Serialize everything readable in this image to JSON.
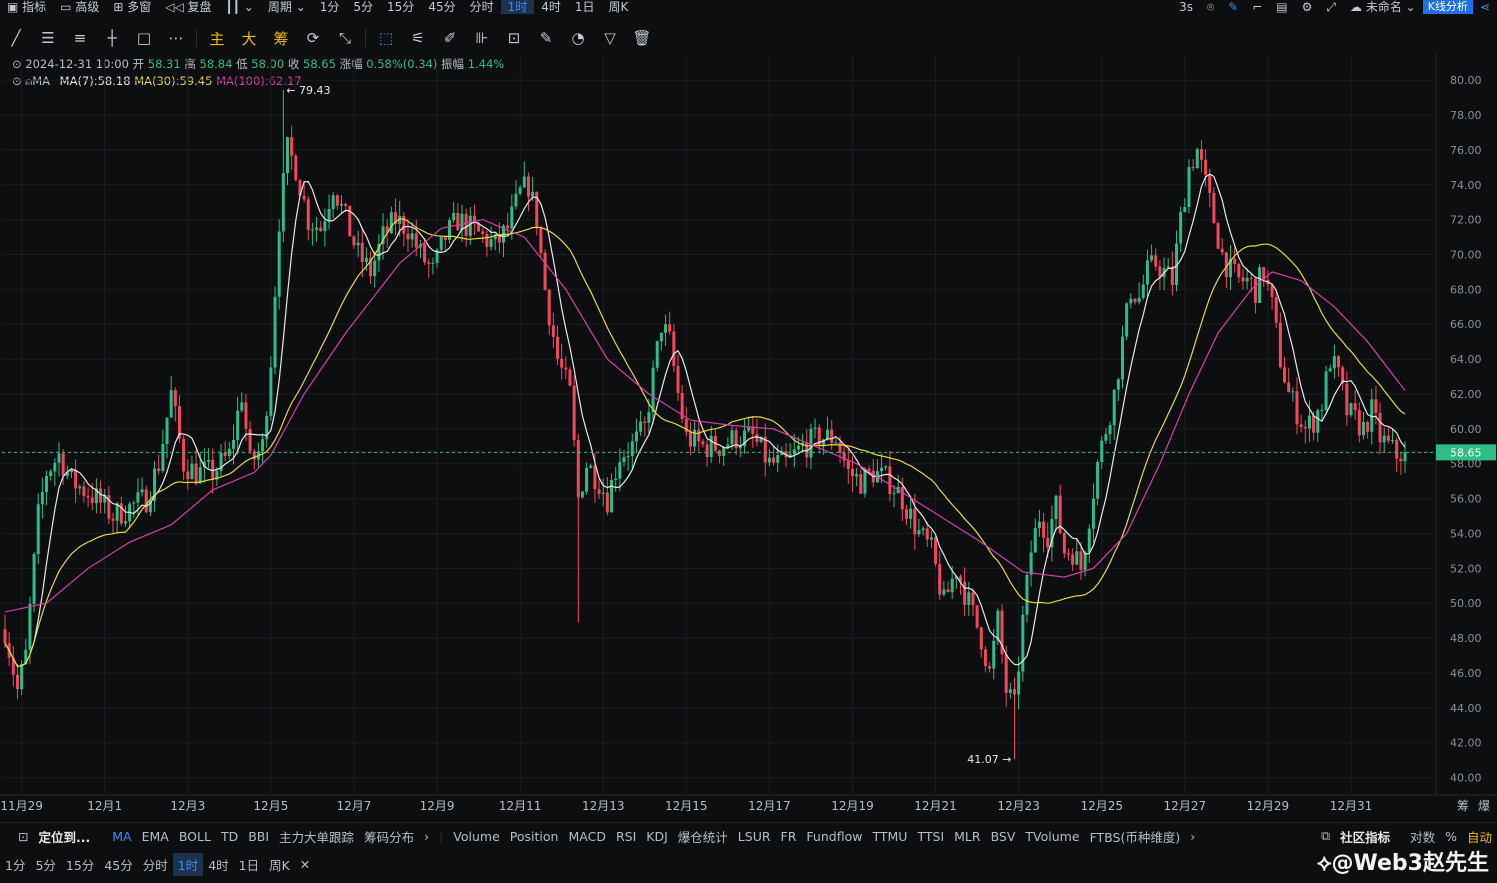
{
  "topbar": {
    "left": [
      "指标",
      "高级",
      "多窗",
      "复盘",
      "周期"
    ],
    "periods": [
      "1分",
      "5分",
      "15分",
      "45分",
      "分时",
      "1时",
      "4时",
      "1日",
      "周K"
    ],
    "active_period": "1时",
    "refresh": "3s",
    "layout_name": "未命名",
    "kline_button": "K线分析"
  },
  "toolbar": {
    "main_label": "主",
    "big_label": "大",
    "chip_label": "筹"
  },
  "info": {
    "datetime": "2024-12-31 10:00",
    "open_label": "开",
    "open": "58.31",
    "high_label": "高",
    "high": "58.84",
    "low_label": "低",
    "low": "58.00",
    "close_label": "收",
    "close": "58.65",
    "change_label": "涨幅",
    "change": "0.58%(0.34)",
    "amp_label": "振幅",
    "amp": "1.44%"
  },
  "ma_legend": {
    "label": "MA",
    "ma7": "MA(7):58.18",
    "ma30": "MA(30):59.45",
    "ma100": "MA(100):62.17"
  },
  "colors": {
    "up": "#2ebd85",
    "down": "#f6465d",
    "ma7": "#e8e8e8",
    "ma30": "#e6d93a",
    "ma100": "#d43fa6",
    "price_tag": "#2ebd85"
  },
  "chart_data": {
    "type": "candlestick",
    "ylim": [
      39,
      81.5
    ],
    "yticks": [
      80,
      78,
      76,
      74,
      72,
      70,
      68,
      66,
      64,
      62,
      60,
      58,
      56,
      54,
      52,
      50,
      48,
      46,
      44,
      42,
      40
    ],
    "ytick_labels": [
      "80.00",
      "78.00",
      "76.00",
      "74.00",
      "72.00",
      "70.00",
      "68.00",
      "66.00",
      "64.00",
      "62.00",
      "60.00",
      "58.00",
      "56.00",
      "54.00",
      "52.00",
      "50.00",
      "48.00",
      "46.00",
      "44.00",
      "42.00",
      "40.00"
    ],
    "xtick_labels": [
      "11月29",
      "12月1",
      "12月3",
      "12月5",
      "12月7",
      "12月9",
      "12月11",
      "12月13",
      "12月15",
      "12月17",
      "12月19",
      "12月21",
      "12月23",
      "12月25",
      "12月27",
      "12月29",
      "12月31"
    ],
    "xtick_hours": [
      4,
      24,
      44,
      64,
      84,
      104,
      124,
      144,
      164,
      184,
      204,
      224,
      244,
      264,
      284,
      304,
      324
    ],
    "last_price": "58.65",
    "last_price_value": 58.65,
    "high_marker": {
      "label": "← 79.43",
      "value": 79.43,
      "hour": 67
    },
    "low_marker": {
      "label": "41.07 →",
      "value": 41.07,
      "hour": 243
    },
    "close_path": [
      [
        0,
        48.5
      ],
      [
        3,
        45
      ],
      [
        5,
        47
      ],
      [
        8,
        55
      ],
      [
        10,
        57.5
      ],
      [
        13,
        58.5
      ],
      [
        16,
        57
      ],
      [
        19,
        56.5
      ],
      [
        22,
        56
      ],
      [
        26,
        55
      ],
      [
        30,
        55.5
      ],
      [
        34,
        56
      ],
      [
        37,
        58
      ],
      [
        40,
        62
      ],
      [
        43,
        58
      ],
      [
        46,
        57.5
      ],
      [
        50,
        57.5
      ],
      [
        54,
        58.5
      ],
      [
        57,
        62
      ],
      [
        59,
        58
      ],
      [
        62,
        59
      ],
      [
        64,
        64
      ],
      [
        66,
        72
      ],
      [
        68,
        76
      ],
      [
        70,
        75
      ],
      [
        73,
        72
      ],
      [
        76,
        71.5
      ],
      [
        79,
        74
      ],
      [
        82,
        72
      ],
      [
        85,
        70
      ],
      [
        88,
        69
      ],
      [
        91,
        71
      ],
      [
        94,
        72
      ],
      [
        97,
        71.5
      ],
      [
        100,
        70
      ],
      [
        103,
        69
      ],
      [
        106,
        71
      ],
      [
        109,
        72
      ],
      [
        112,
        71.5
      ],
      [
        115,
        71
      ],
      [
        118,
        70.5
      ],
      [
        121,
        71.5
      ],
      [
        124,
        73.5
      ],
      [
        126,
        74
      ],
      [
        128,
        72
      ],
      [
        130,
        68
      ],
      [
        133,
        64
      ],
      [
        136,
        62
      ],
      [
        138,
        56
      ],
      [
        140,
        58
      ],
      [
        143,
        57
      ],
      [
        145,
        56
      ],
      [
        148,
        58.5
      ],
      [
        151,
        59
      ],
      [
        154,
        60
      ],
      [
        156,
        63
      ],
      [
        158,
        66
      ],
      [
        160,
        65
      ],
      [
        162,
        62
      ],
      [
        164,
        59.5
      ],
      [
        168,
        59
      ],
      [
        172,
        59
      ],
      [
        176,
        59.5
      ],
      [
        180,
        59.5
      ],
      [
        184,
        58
      ],
      [
        188,
        58
      ],
      [
        192,
        59
      ],
      [
        196,
        59.5
      ],
      [
        200,
        59.5
      ],
      [
        203,
        57.5
      ],
      [
        206,
        57
      ],
      [
        209,
        57.5
      ],
      [
        213,
        57
      ],
      [
        216,
        56
      ],
      [
        220,
        54
      ],
      [
        223,
        53
      ],
      [
        226,
        50
      ],
      [
        229,
        52
      ],
      [
        232,
        50
      ],
      [
        235,
        48
      ],
      [
        237,
        46
      ],
      [
        239,
        49
      ],
      [
        241,
        45
      ],
      [
        243,
        44
      ],
      [
        245,
        49
      ],
      [
        247,
        53
      ],
      [
        249,
        55
      ],
      [
        251,
        54
      ],
      [
        253,
        55.5
      ],
      [
        255,
        53
      ],
      [
        257,
        53
      ],
      [
        259,
        52
      ],
      [
        261,
        55
      ],
      [
        263,
        58
      ],
      [
        265,
        60
      ],
      [
        267,
        62
      ],
      [
        269,
        65
      ],
      [
        271,
        68
      ],
      [
        273,
        67.5
      ],
      [
        275,
        69
      ],
      [
        277,
        69.5
      ],
      [
        279,
        69
      ],
      [
        281,
        68.5
      ],
      [
        283,
        72
      ],
      [
        285,
        75
      ],
      [
        287,
        76
      ],
      [
        289,
        74
      ],
      [
        291,
        72
      ],
      [
        293,
        70
      ],
      [
        295,
        69
      ],
      [
        297,
        68.5
      ],
      [
        299,
        68.5
      ],
      [
        301,
        68
      ],
      [
        303,
        69
      ],
      [
        305,
        67
      ],
      [
        307,
        64
      ],
      [
        309,
        62
      ],
      [
        311,
        61
      ],
      [
        313,
        60
      ],
      [
        315,
        60.5
      ],
      [
        317,
        61.5
      ],
      [
        319,
        64
      ],
      [
        321,
        63
      ],
      [
        323,
        61
      ],
      [
        325,
        60.5
      ],
      [
        327,
        60
      ],
      [
        329,
        61
      ],
      [
        331,
        59.5
      ],
      [
        333,
        59
      ],
      [
        335,
        58.5
      ],
      [
        337,
        58.7
      ]
    ],
    "ma100_path": [
      [
        0,
        49.5
      ],
      [
        10,
        50
      ],
      [
        20,
        52
      ],
      [
        30,
        53.5
      ],
      [
        40,
        54.5
      ],
      [
        50,
        56.5
      ],
      [
        60,
        57.5
      ],
      [
        64,
        58.5
      ],
      [
        72,
        62
      ],
      [
        82,
        65.5
      ],
      [
        95,
        69.5
      ],
      [
        105,
        71.5
      ],
      [
        115,
        72
      ],
      [
        125,
        71
      ],
      [
        135,
        68
      ],
      [
        145,
        64
      ],
      [
        155,
        62
      ],
      [
        165,
        60.5
      ],
      [
        175,
        60.2
      ],
      [
        185,
        60
      ],
      [
        195,
        59
      ],
      [
        205,
        58
      ],
      [
        215,
        56.5
      ],
      [
        225,
        55
      ],
      [
        235,
        53.5
      ],
      [
        245,
        51.8
      ],
      [
        255,
        51.5
      ],
      [
        262,
        52
      ],
      [
        270,
        54
      ],
      [
        278,
        58
      ],
      [
        285,
        62
      ],
      [
        292,
        65.5
      ],
      [
        300,
        68
      ],
      [
        305,
        69
      ],
      [
        312,
        68.5
      ],
      [
        320,
        67
      ],
      [
        328,
        65
      ],
      [
        337,
        62.2
      ]
    ]
  },
  "bottom_indicators": {
    "locate": "定位到...",
    "main": [
      "MA",
      "EMA",
      "BOLL",
      "TD",
      "BBI",
      "主力大单跟踪",
      "筹码分布"
    ],
    "sub": [
      "Volume",
      "Position",
      "MACD",
      "RSI",
      "KDJ",
      "爆仓统计",
      "LSUR",
      "FR",
      "Fundflow",
      "TTMU",
      "TTSI",
      "MLR",
      "BSV",
      "TVolume",
      "FTBS(币种维度)"
    ],
    "community": "社区指标",
    "log": "对数",
    "pct": "%",
    "auto": "自动"
  },
  "bottom_periods": [
    "1分",
    "5分",
    "15分",
    "45分",
    "分时",
    "1时",
    "4时",
    "1日",
    "周K"
  ],
  "watermark": "@Web3赵先生"
}
